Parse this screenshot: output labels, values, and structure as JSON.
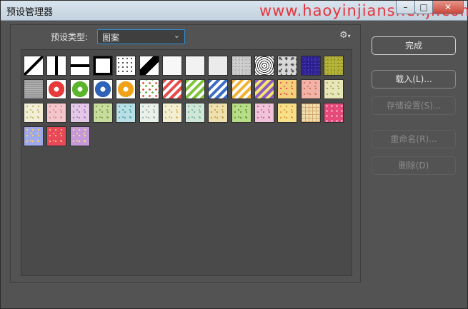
{
  "window": {
    "title": "预设管理器",
    "watermark": "www.haoyinjianshenji.com",
    "controls": {
      "minimize": "–",
      "maximize": "□",
      "close": "✕"
    }
  },
  "preset_type": {
    "label": "预设类型:",
    "value": "图案"
  },
  "gear_icon": "gear-icon",
  "swatches": [
    {
      "kind": "diag-line",
      "bg": "#ffffff",
      "fg": "#000000"
    },
    {
      "kind": "vbar",
      "bg": "#ffffff",
      "fg": "#000000"
    },
    {
      "kind": "hbar",
      "bg": "#ffffff",
      "fg": "#000000"
    },
    {
      "kind": "frame",
      "bg": "#ffffff",
      "fg": "#000000"
    },
    {
      "kind": "dots-bw",
      "bg": "#ffffff",
      "fg": "#000000"
    },
    {
      "kind": "diag-thick",
      "bg": "#ffffff",
      "fg": "#000000"
    },
    {
      "kind": "plain",
      "bg": "#f7f7f7",
      "fg": "#f7f7f7"
    },
    {
      "kind": "plain",
      "bg": "#f2f2f2",
      "fg": "#f2f2f2"
    },
    {
      "kind": "plain",
      "bg": "#ebebeb",
      "fg": "#ebebeb"
    },
    {
      "kind": "noise",
      "bg": "#d0d0d0",
      "fg": "#a0a0a0"
    },
    {
      "kind": "concentric",
      "bg": "#ffffff",
      "fg": "#333333"
    },
    {
      "kind": "camo",
      "bg": "#d8d8d8",
      "fg": "#555555"
    },
    {
      "kind": "noise",
      "bg": "#2a1f8a",
      "fg": "#5a3fd0"
    },
    {
      "kind": "noise",
      "bg": "#b7b63a",
      "fg": "#7d7d20"
    },
    {
      "kind": "stripes-h",
      "bg": "#9a9a9a",
      "fg": "#b5b5b5"
    },
    {
      "kind": "ring",
      "bg": "#ffffff",
      "fg": "#e83a3a"
    },
    {
      "kind": "ring",
      "bg": "#ffffff",
      "fg": "#5bb52a"
    },
    {
      "kind": "ring",
      "bg": "#ffffff",
      "fg": "#2f63b7"
    },
    {
      "kind": "ring",
      "bg": "#ffffff",
      "fg": "#f0a21a"
    },
    {
      "kind": "multidots",
      "bg": "#ffffff",
      "fg": "#e7503a"
    },
    {
      "kind": "stripes-d",
      "bg": "#ffffff",
      "fg": "#e84b4b"
    },
    {
      "kind": "stripes-d",
      "bg": "#ffffff",
      "fg": "#7cc43a"
    },
    {
      "kind": "stripes-d",
      "bg": "#ffffff",
      "fg": "#3a6cc4"
    },
    {
      "kind": "stripes-d",
      "bg": "#ffffff",
      "fg": "#f2b233"
    },
    {
      "kind": "stripes-d",
      "bg": "#f6e56e",
      "fg": "#8a5cc4"
    },
    {
      "kind": "floral",
      "bg": "#f4d07a",
      "fg": "#e45a4a"
    },
    {
      "kind": "floral",
      "bg": "#f1b3a8",
      "fg": "#d8735c"
    },
    {
      "kind": "floral",
      "bg": "#e8e6b8",
      "fg": "#9cae5a"
    },
    {
      "kind": "floral",
      "bg": "#f2efd8",
      "fg": "#c8b86a"
    },
    {
      "kind": "floral",
      "bg": "#f3c6cc",
      "fg": "#e48a9a"
    },
    {
      "kind": "floral",
      "bg": "#e4c8e8",
      "fg": "#b27cc2"
    },
    {
      "kind": "floral",
      "bg": "#c8dca0",
      "fg": "#7fa64a"
    },
    {
      "kind": "floral",
      "bg": "#b9dfe4",
      "fg": "#4eaab4"
    },
    {
      "kind": "floral",
      "bg": "#eaf0ea",
      "fg": "#9ab6a8"
    },
    {
      "kind": "floral",
      "bg": "#f3efd2",
      "fg": "#d6b45e"
    },
    {
      "kind": "floral",
      "bg": "#cfe6d8",
      "fg": "#7cb89a"
    },
    {
      "kind": "floral",
      "bg": "#eee0b0",
      "fg": "#c9a23e"
    },
    {
      "kind": "floral",
      "bg": "#b8dc88",
      "fg": "#6c9c3a"
    },
    {
      "kind": "floral",
      "bg": "#f0c4d8",
      "fg": "#d06a98"
    },
    {
      "kind": "floral",
      "bg": "#f6e08a",
      "fg": "#e09a3a"
    },
    {
      "kind": "plaid",
      "bg": "#f0dfb0",
      "fg": "#d5a86a"
    },
    {
      "kind": "polka",
      "bg": "#e64a7a",
      "fg": "#ffffff"
    },
    {
      "kind": "floral",
      "bg": "#9fa8e8",
      "fg": "#ffd25a"
    },
    {
      "kind": "floral",
      "bg": "#e8485a",
      "fg": "#ffb86a"
    },
    {
      "kind": "floral",
      "bg": "#c49ad8",
      "fg": "#f4e07a"
    }
  ],
  "buttons": {
    "done": "完成",
    "load": "载入(L)...",
    "save": "存储设置(S)...",
    "rename": "重命名(R)...",
    "delete": "删除(D)"
  }
}
